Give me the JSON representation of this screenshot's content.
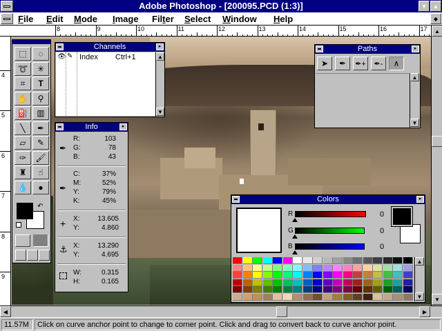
{
  "window": {
    "title": "Adobe Photoshop - [200095.PCD  (1:3)]"
  },
  "menu": [
    {
      "label": "File",
      "ul": "F"
    },
    {
      "label": "Edit",
      "ul": "E"
    },
    {
      "label": "Mode",
      "ul": "M"
    },
    {
      "label": "Image",
      "ul": "I"
    },
    {
      "label": "Filter",
      "ul": "t"
    },
    {
      "label": "Select",
      "ul": "S"
    },
    {
      "label": "Window",
      "ul": "W"
    },
    {
      "label": "Help",
      "ul": "H"
    }
  ],
  "hruler": [
    "8",
    "9",
    "10",
    "11",
    "12",
    "13",
    "14",
    "15",
    "16",
    "17"
  ],
  "vruler": [
    "3",
    "4",
    "5",
    "6",
    "7",
    "8",
    "9",
    "10"
  ],
  "toolbox": {
    "tools": [
      "rect-marquee",
      "ellipse-marquee",
      "lasso",
      "magic-wand",
      "crop",
      "type",
      "hand",
      "zoom",
      "paint-bucket",
      "gradient",
      "line",
      "eyedropper",
      "eraser",
      "pencil",
      "airbrush",
      "paintbrush",
      "rubber-stamp",
      "smudge",
      "blur",
      "burn"
    ],
    "fg_color": "#000000",
    "bg_color": "#ffffff"
  },
  "channels": {
    "title": "Channels",
    "rows": [
      {
        "name": "Index",
        "shortcut": "Ctrl+1"
      }
    ]
  },
  "info": {
    "title": "Info",
    "rgb": {
      "R": "103",
      "G": "78",
      "B": "43"
    },
    "cmyk": {
      "C": "37%",
      "M": "52%",
      "Y": "79%",
      "K": "45%"
    },
    "pos1": {
      "X": "13.605",
      "Y": "4.860"
    },
    "pos2": {
      "X": "13.290",
      "Y": "4.695"
    },
    "size": {
      "W": "0.315",
      "H": "0.165"
    }
  },
  "paths": {
    "title": "Paths",
    "tools": [
      "arrow",
      "pen",
      "add-anchor",
      "remove-anchor",
      "convert-point"
    ]
  },
  "colors": {
    "title": "Colors",
    "r_label": "R",
    "g_label": "G",
    "b_label": "B",
    "r_value": "0",
    "g_value": "0",
    "b_value": "0",
    "preview": "#ffffff",
    "fg": "#000000",
    "bg": "#ffffff",
    "swatches": [
      [
        "#ff0000",
        "#ffff00",
        "#00ff00",
        "#00ffff",
        "#0000ff",
        "#ff00ff",
        "#ffffff",
        "#e8e8e8",
        "#d0d0d0",
        "#b8b8b8",
        "#a0a0a0",
        "#888888",
        "#707070",
        "#585858",
        "#404040",
        "#282828",
        "#101010",
        "#000000"
      ],
      [
        "#ff8080",
        "#ffc080",
        "#ffff80",
        "#c0ff80",
        "#80ff80",
        "#80ffc0",
        "#80ffff",
        "#80c0ff",
        "#8080ff",
        "#c080ff",
        "#ff80ff",
        "#ff80c0",
        "#ffa0a0",
        "#ffd0a0",
        "#e0e0a0",
        "#a0e0a0",
        "#a0e0e0",
        "#a0a0e0"
      ],
      [
        "#ff4040",
        "#ff8000",
        "#ffff00",
        "#80ff00",
        "#00ff00",
        "#00ff80",
        "#00ffff",
        "#0080ff",
        "#0000ff",
        "#8000ff",
        "#ff00ff",
        "#ff0080",
        "#c04040",
        "#c08040",
        "#c0c040",
        "#40c040",
        "#40c0c0",
        "#4040c0"
      ],
      [
        "#c00000",
        "#c06000",
        "#c0c000",
        "#60c000",
        "#00c000",
        "#00c060",
        "#00c0c0",
        "#0060c0",
        "#0000c0",
        "#6000c0",
        "#c000c0",
        "#c00060",
        "#a02020",
        "#a06020",
        "#a0a020",
        "#20a020",
        "#20a0a0",
        "#2020a0"
      ],
      [
        "#800000",
        "#804000",
        "#808000",
        "#408000",
        "#008000",
        "#008040",
        "#008080",
        "#004080",
        "#000080",
        "#400080",
        "#800080",
        "#800040",
        "#600000",
        "#603000",
        "#606000",
        "#006000",
        "#006060",
        "#000060"
      ],
      [
        "#c8b090",
        "#d0a070",
        "#c09060",
        "#a08060",
        "#e0c0a0",
        "#f0d8b0",
        "#b09070",
        "#907050",
        "#705030",
        "#c0a080",
        "#a08040",
        "#806020",
        "#604020",
        "#402010",
        "#d8c0a0",
        "#c0a890",
        "#a89078",
        "#907860"
      ]
    ]
  },
  "status": {
    "memory": "11.57M",
    "message": "Click on curve anchor point to change to corner point.  Click and drag to convert back to curve anchor point."
  }
}
